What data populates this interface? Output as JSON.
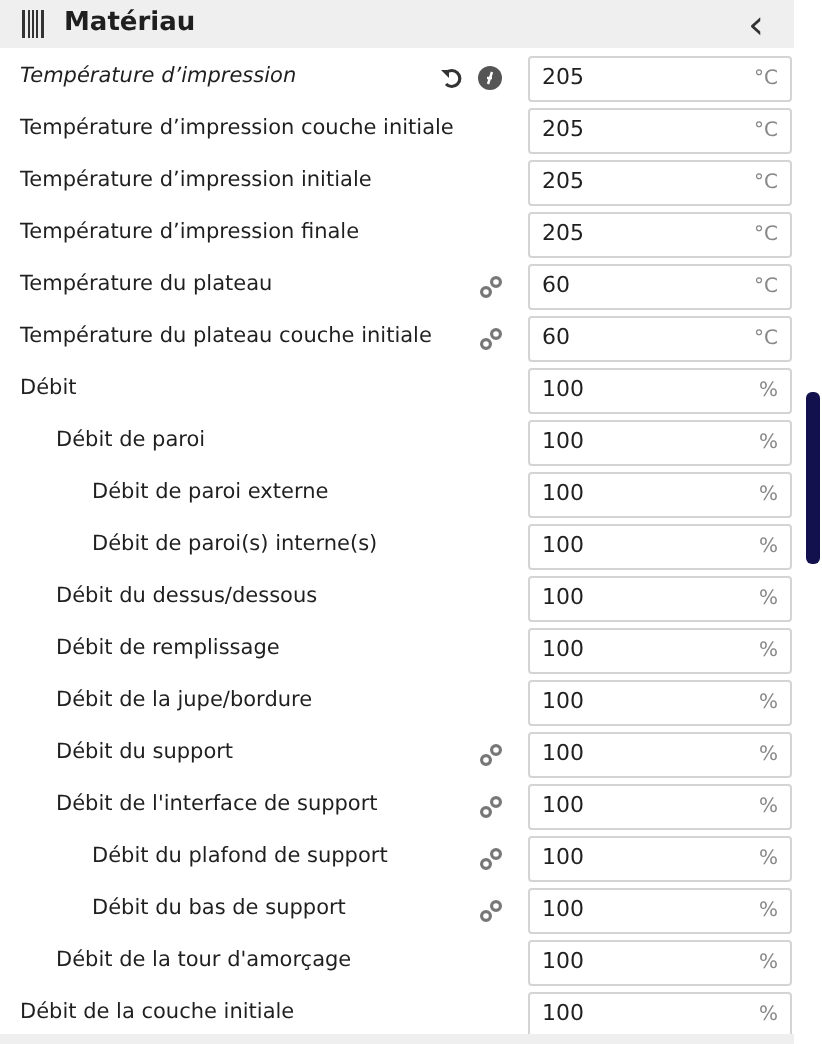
{
  "header": {
    "title": "Matériau",
    "collapse_glyph": "‹"
  },
  "settings": [
    {
      "label": "Température d’impression",
      "value": "205",
      "unit": "°C",
      "modified": true,
      "inherit": true,
      "linked": false
    },
    {
      "label": "Température d’impression couche initiale",
      "value": "205",
      "unit": "°C",
      "modified": false,
      "inherit": false,
      "linked": false
    },
    {
      "label": "Température d’impression initiale",
      "value": "205",
      "unit": "°C",
      "modified": false,
      "inherit": false,
      "linked": false
    },
    {
      "label": "Température d’impression finale",
      "value": "205",
      "unit": "°C",
      "modified": false,
      "inherit": false,
      "linked": false
    },
    {
      "label": "Température du plateau",
      "value": "60",
      "unit": "°C",
      "modified": false,
      "inherit": false,
      "linked": true
    },
    {
      "label": "Température du plateau couche initiale",
      "value": "60",
      "unit": "°C",
      "modified": false,
      "inherit": false,
      "linked": true
    },
    {
      "label": "Débit",
      "value": "100",
      "unit": "%",
      "modified": false,
      "inherit": false,
      "linked": false,
      "children": [
        {
          "label": "Débit de paroi",
          "value": "100",
          "unit": "%",
          "modified": false,
          "inherit": false,
          "linked": false,
          "children": [
            {
              "label": "Débit de paroi externe",
              "value": "100",
              "unit": "%",
              "modified": false,
              "inherit": false,
              "linked": false
            },
            {
              "label": "Débit de paroi(s) interne(s)",
              "value": "100",
              "unit": "%",
              "modified": false,
              "inherit": false,
              "linked": false
            }
          ]
        },
        {
          "label": "Débit du dessus/dessous",
          "value": "100",
          "unit": "%",
          "modified": false,
          "inherit": false,
          "linked": false
        },
        {
          "label": "Débit de remplissage",
          "value": "100",
          "unit": "%",
          "modified": false,
          "inherit": false,
          "linked": false
        },
        {
          "label": "Débit de la jupe/bordure",
          "value": "100",
          "unit": "%",
          "modified": false,
          "inherit": false,
          "linked": false
        },
        {
          "label": "Débit du support",
          "value": "100",
          "unit": "%",
          "modified": false,
          "inherit": false,
          "linked": true
        },
        {
          "label": "Débit de l'interface de support",
          "value": "100",
          "unit": "%",
          "modified": false,
          "inherit": false,
          "linked": true,
          "children": [
            {
              "label": "Débit du plafond de support",
              "value": "100",
              "unit": "%",
              "modified": false,
              "inherit": false,
              "linked": true
            },
            {
              "label": "Débit du bas de support",
              "value": "100",
              "unit": "%",
              "modified": false,
              "inherit": false,
              "linked": true
            }
          ]
        },
        {
          "label": "Débit de la tour d'amorçage",
          "value": "100",
          "unit": "%",
          "modified": false,
          "inherit": false,
          "linked": false
        }
      ]
    },
    {
      "label": "Débit de la couche initiale",
      "value": "100",
      "unit": "%",
      "modified": false,
      "inherit": false,
      "linked": false
    }
  ]
}
